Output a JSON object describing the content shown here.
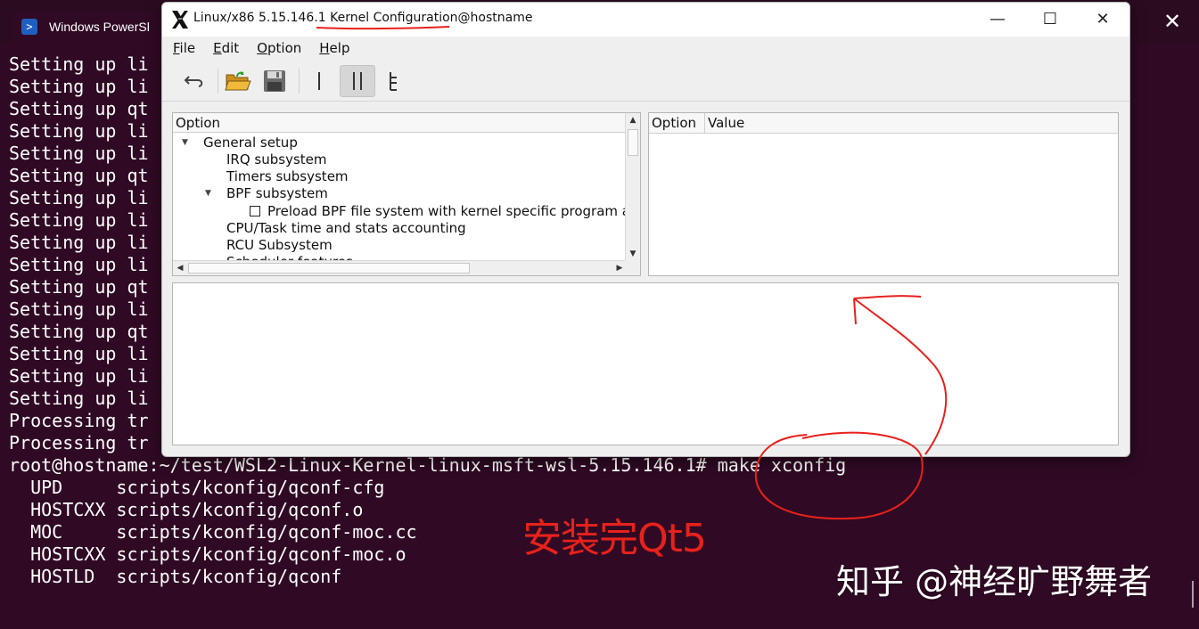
{
  "terminal": {
    "tab_title": "Windows PowerShell",
    "tab_icon": "powershell-icon",
    "close_glyph": "✕",
    "lines": [
      "Setting up li",
      "Setting up li",
      "Setting up qt",
      "Setting up li",
      "Setting up li",
      "Setting up qt",
      "Setting up li",
      "Setting up li",
      "Setting up li",
      "Setting up li",
      "Setting up qt",
      "Setting up li",
      "Setting up qt",
      "Setting up li",
      "Setting up li",
      "Setting up li",
      "Processing tr",
      "Processing tr",
      "root@hostname:~/test/WSL2-Linux-Kernel-linux-msft-wsl-5.15.146.1# make xconfig",
      "  UPD     scripts/kconfig/qconf-cfg",
      "  HOSTCXX scripts/kconfig/qconf.o",
      "  MOC     scripts/kconfig/qconf-moc.cc",
      "  HOSTCXX scripts/kconfig/qconf-moc.o",
      "  HOSTLD  scripts/kconfig/qconf"
    ]
  },
  "xconfig": {
    "title_prefix": "Linux/x86 5.15.146.1 ",
    "title_highlight": "Kernel Configuration@hostname",
    "window_buttons": {
      "minimize": "—",
      "maximize": "☐",
      "close": "✕"
    },
    "menu": [
      {
        "mnemonic": "F",
        "rest": "ile"
      },
      {
        "mnemonic": "E",
        "rest": "dit"
      },
      {
        "mnemonic": "O",
        "rest": "ption"
      },
      {
        "mnemonic": "H",
        "rest": "elp"
      }
    ],
    "toolbar": {
      "back_icon": "back-icon",
      "load_icon": "open-folder-icon",
      "save_icon": "save-icon",
      "single_view_icon": "single-view-icon",
      "split_view_icon": "split-view-icon",
      "full_view_icon": "full-view-icon"
    },
    "option_panel": {
      "header": "Option",
      "rows": [
        {
          "level": 0,
          "arrow": "expanded",
          "checkbox": false,
          "label": "General setup"
        },
        {
          "level": 1,
          "arrow": "none",
          "checkbox": false,
          "label": "IRQ subsystem"
        },
        {
          "level": 1,
          "arrow": "none",
          "checkbox": false,
          "label": "Timers subsystem"
        },
        {
          "level": 1,
          "arrow": "expanded",
          "checkbox": false,
          "label": "BPF subsystem"
        },
        {
          "level": 2,
          "arrow": "none",
          "checkbox": true,
          "label": "Preload BPF file system with kernel specific program a"
        },
        {
          "level": 1,
          "arrow": "none",
          "checkbox": false,
          "label": "CPU/Task time and stats accounting"
        },
        {
          "level": 1,
          "arrow": "none",
          "checkbox": false,
          "label": "RCU Subsystem"
        },
        {
          "level": 1,
          "arrow": "none",
          "checkbox": false,
          "label": "Scheduler features"
        }
      ]
    },
    "value_panel": {
      "col_option": "Option",
      "col_value": "Value"
    }
  },
  "annotations": {
    "caption": "安装完Qt5",
    "watermark": "知乎 @神经旷野舞者",
    "color": "#e8211c"
  }
}
